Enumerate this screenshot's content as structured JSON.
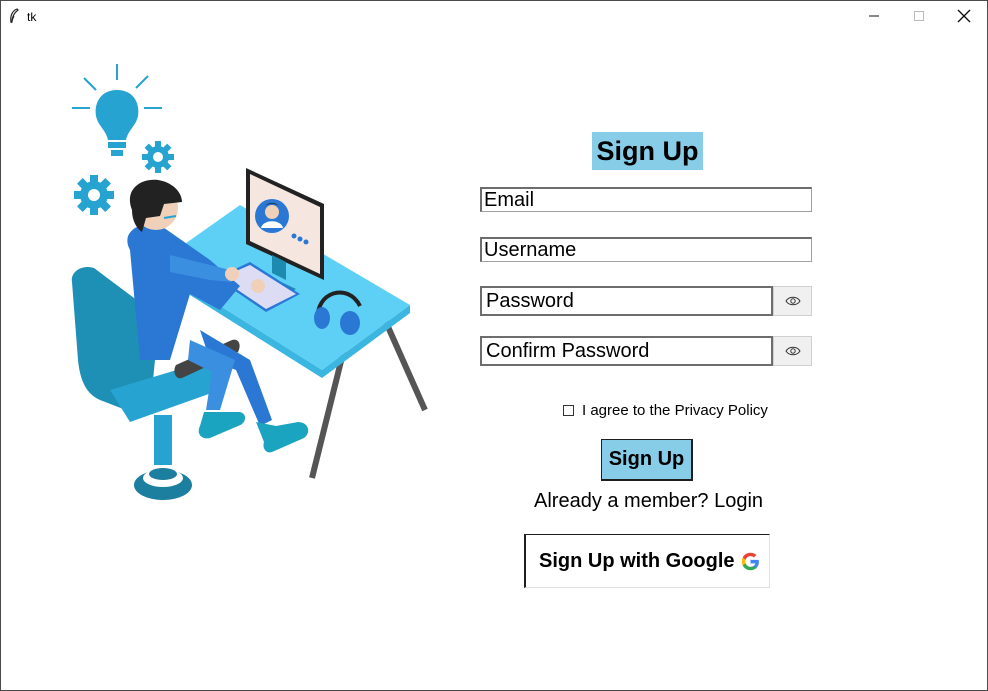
{
  "window": {
    "title": "tk",
    "icon": "feather-icon",
    "controls": [
      "minimize-icon",
      "maximize-icon",
      "close-icon"
    ]
  },
  "form": {
    "title": "Sign Up",
    "email_value": "Email",
    "username_value": "Username",
    "password_value": "Password",
    "confirm_password_value": "Confirm Password",
    "show_password_icon": "eye-icon",
    "agree_label": "I agree to the Privacy Policy",
    "agree_checked": false,
    "submit_label": "Sign Up",
    "login_prompt": "Already a member? Login",
    "google_label": "Sign Up with Google",
    "google_icon": "google-g-icon"
  },
  "colors": {
    "accent": "#87cde8",
    "illustration_primary": "#26a3d1",
    "illustration_desk": "#5fd0f5"
  }
}
